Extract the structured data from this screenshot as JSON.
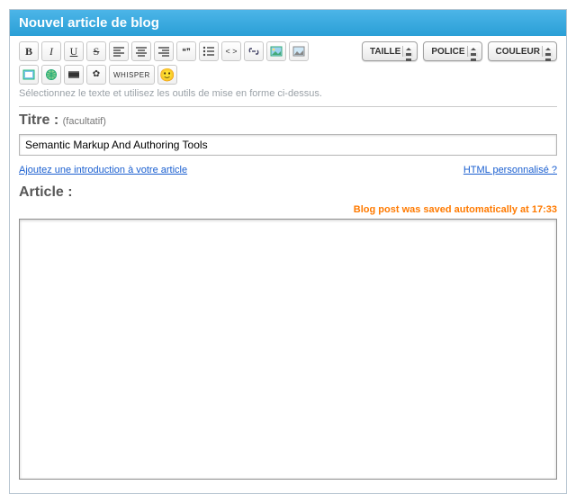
{
  "header": {
    "title": "Nouvel article de blog"
  },
  "toolbar": {
    "row1": {
      "bold_glyph": "B",
      "italic_glyph": "I",
      "underline_glyph": "U",
      "strike_glyph": "S",
      "whisper_label": "WHISPER"
    },
    "selects": {
      "size_label": "TAILLE",
      "font_label": "POLICE",
      "color_label": "COULEUR"
    },
    "help_text": "Sélectionnez le texte et utilisez les outils de mise en forme ci-dessus."
  },
  "title_section": {
    "label": "Titre :",
    "hint": "(facultatif)",
    "value": "Semantic Markup And Authoring Tools"
  },
  "links": {
    "intro_link": "Ajoutez une introduction à votre article",
    "custom_html_link": "HTML personnalisé ?"
  },
  "article_section": {
    "label": "Article :",
    "autosave_text": "Blog post was saved automatically at 17:33",
    "body_value": ""
  }
}
